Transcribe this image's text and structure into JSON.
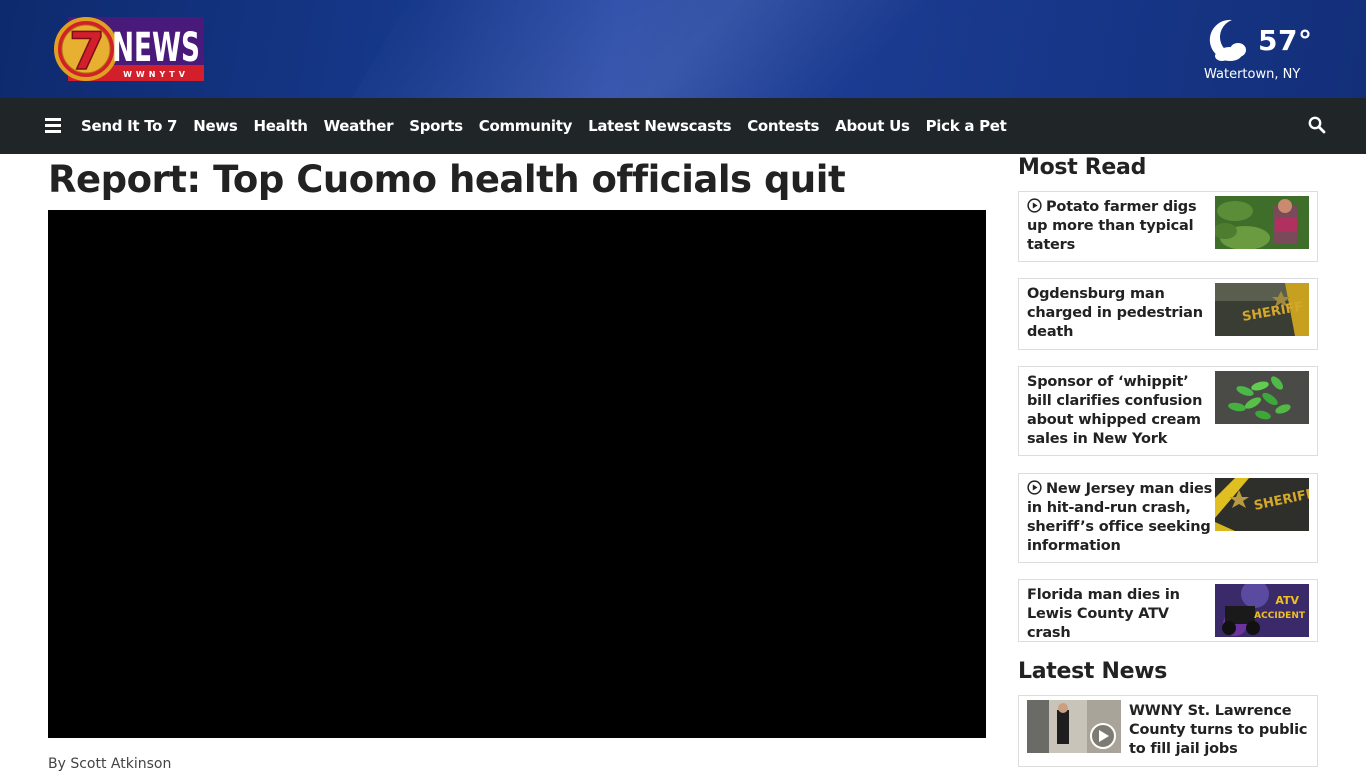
{
  "brand": {
    "logo_number": "7",
    "logo_word": "NEWS",
    "logo_sub": "WWNYTV"
  },
  "weather": {
    "temp": "57°",
    "location": "Watertown, NY",
    "icon": "moon-cloud-icon"
  },
  "nav": {
    "items": [
      "Send It To 7",
      "News",
      "Health",
      "Weather",
      "Sports",
      "Community",
      "Latest Newscasts",
      "Contests",
      "About Us",
      "Pick a Pet"
    ]
  },
  "article": {
    "headline": "Report: Top Cuomo health officials quit",
    "byline": "By Scott Atkinson"
  },
  "most_read": {
    "title": "Most Read",
    "items": [
      {
        "text": "Potato farmer digs up more than typical taters",
        "video": true
      },
      {
        "text": "Ogdensburg man charged in pedestrian death",
        "video": false
      },
      {
        "text": "Sponsor of ‘whippit’ bill clarifies confusion about whipped cream sales in New York",
        "video": false
      },
      {
        "text": "New Jersey man dies in hit-and-run crash, sheriff’s office seeking information",
        "video": true
      },
      {
        "text": "Florida man dies in Lewis County ATV crash",
        "video": false
      }
    ]
  },
  "latest_news": {
    "title": "Latest News",
    "items": [
      {
        "text": "WWNY St. Lawrence County turns to public to fill jail jobs",
        "video": true
      }
    ]
  },
  "thumb_text": {
    "sheriff": "SHERIFF",
    "atv": "ATV",
    "accident": "ACCIDENT"
  },
  "colors": {
    "banner": "#16388a",
    "navbar": "#202628",
    "logo_red": "#d21f2b",
    "logo_gold": "#e0a020"
  }
}
